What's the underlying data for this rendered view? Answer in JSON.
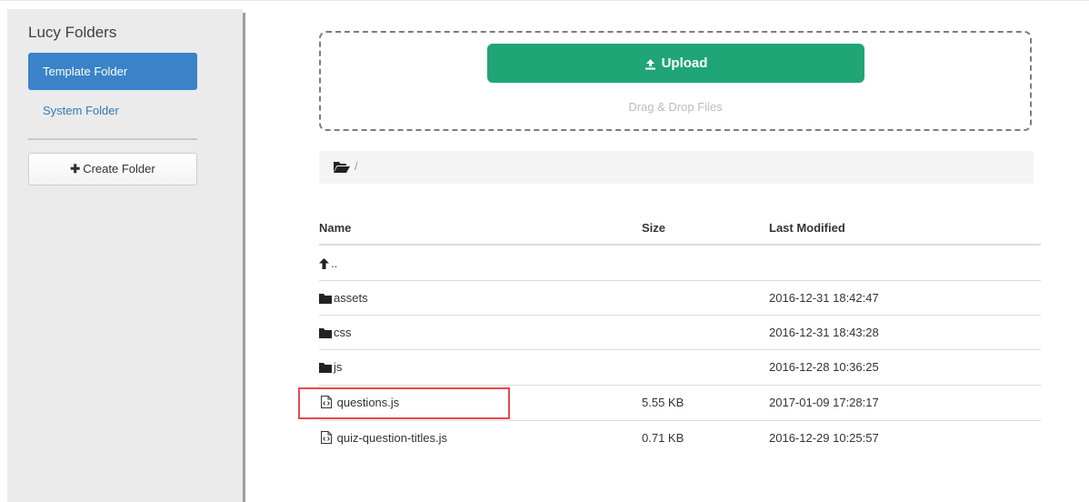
{
  "sidebar": {
    "title": "Lucy Folders",
    "items": [
      {
        "label": "Template Folder",
        "active": true
      },
      {
        "label": "System Folder",
        "active": false
      }
    ],
    "create_folder_label": "Create Folder"
  },
  "upload": {
    "button_label": "Upload",
    "drop_hint": "Drag & Drop Files"
  },
  "breadcrumb": {
    "icon": "folder-open-icon",
    "separator": "/"
  },
  "table": {
    "headers": [
      "Name",
      "Size",
      "Last Modified"
    ],
    "parent_link": "..",
    "rows": [
      {
        "icon": "folder-icon",
        "name": "assets",
        "size": "",
        "modified": "2016-12-31 18:42:47"
      },
      {
        "icon": "folder-icon",
        "name": "css",
        "size": "",
        "modified": "2016-12-31 18:43:28"
      },
      {
        "icon": "folder-icon",
        "name": "js",
        "size": "",
        "modified": "2016-12-28 10:36:25"
      },
      {
        "icon": "file-code-icon",
        "name": "questions.js",
        "size": "5.55 KB",
        "modified": "2017-01-09 17:28:17"
      },
      {
        "icon": "file-code-icon",
        "name": "quiz-question-titles.js",
        "size": "0.71 KB",
        "modified": "2016-12-29 10:25:57"
      }
    ]
  },
  "colors": {
    "accent_blue": "#3a83c8",
    "upload_green": "#1fa576",
    "highlight_red": "#e8474e"
  }
}
